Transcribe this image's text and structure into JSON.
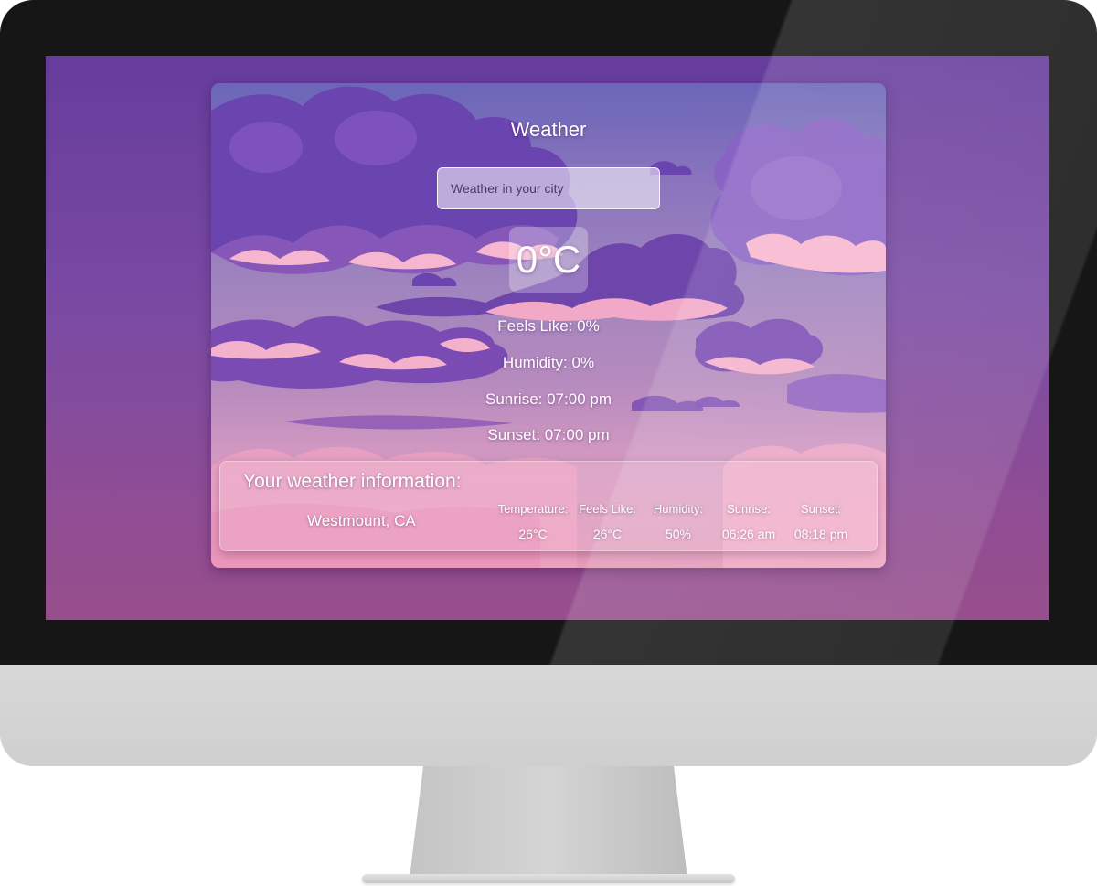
{
  "app": {
    "title": "Weather",
    "search_placeholder": "Weather in your city",
    "temperature": "0°C",
    "feels_like": "Feels Like: 0%",
    "humidity": "Humidity: 0%",
    "sunrise": "Sunrise: 07:00 pm",
    "sunset": "Sunset: 07:00 pm"
  },
  "info_panel": {
    "title": "Your weather information:",
    "city": "Westmount, CA",
    "columns": [
      {
        "label": "Temperature:",
        "value": "26°C"
      },
      {
        "label": "Feels Like:",
        "value": "26°C"
      },
      {
        "label": "Humidity:",
        "value": "50%"
      },
      {
        "label": "Sunrise:",
        "value": "06:26 am"
      },
      {
        "label": "Sunset:",
        "value": "08:18 pm"
      }
    ]
  },
  "colors": {
    "screen_background": "#7a4aa3",
    "cloud_dark": "#6b3fa6",
    "cloud_highlight": "#f6b2cc",
    "text": "#ffffff"
  }
}
